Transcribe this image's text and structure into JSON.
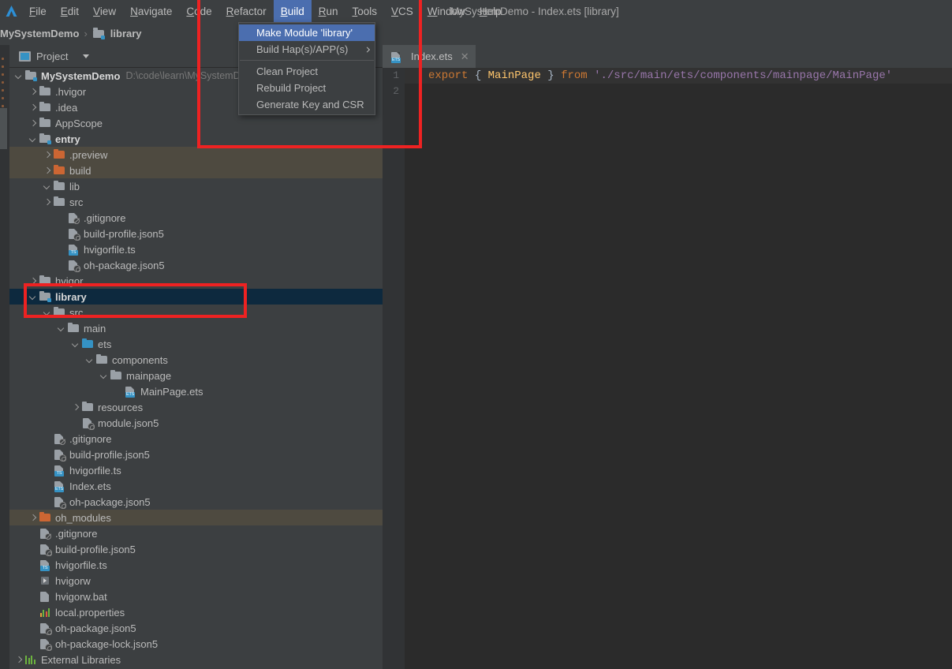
{
  "app": {
    "window_title": "MySystemDemo - Index.ets [library]",
    "logo_icon": "deveco-studio-logo-icon"
  },
  "menubar": {
    "items": [
      {
        "label": "File",
        "active": false
      },
      {
        "label": "Edit",
        "active": false
      },
      {
        "label": "View",
        "active": false
      },
      {
        "label": "Navigate",
        "active": false
      },
      {
        "label": "Code",
        "active": false
      },
      {
        "label": "Refactor",
        "active": false
      },
      {
        "label": "Build",
        "active": true
      },
      {
        "label": "Run",
        "active": false
      },
      {
        "label": "Tools",
        "active": false
      },
      {
        "label": "VCS",
        "active": false
      },
      {
        "label": "Window",
        "active": false
      },
      {
        "label": "Help",
        "active": false
      }
    ]
  },
  "build_menu": {
    "items": [
      {
        "label": "Make Module 'library'",
        "highlighted": true,
        "submenu": false,
        "separator_after": false
      },
      {
        "label": "Build Hap(s)/APP(s)",
        "highlighted": false,
        "submenu": true,
        "separator_after": true
      },
      {
        "label": "Clean Project",
        "highlighted": false,
        "submenu": false,
        "separator_after": false
      },
      {
        "label": "Rebuild Project",
        "highlighted": false,
        "submenu": false,
        "separator_after": false
      },
      {
        "label": "Generate Key and CSR",
        "highlighted": false,
        "submenu": false,
        "separator_after": false
      }
    ]
  },
  "breadcrumb": {
    "project": "MySystemDemo",
    "separator": "›",
    "module": "library",
    "module_icon": "module-folder-icon"
  },
  "tool_window": {
    "title": "Project",
    "view_icon": "project-view-icon",
    "dropdown_icon": "chevron-down-icon"
  },
  "tree": [
    {
      "indent": 0,
      "arrow": "down",
      "icon": "module-folder",
      "label": "MySystemDemo",
      "bold": true,
      "path": "D:\\code\\learn\\MySystemDemo",
      "state": "normal"
    },
    {
      "indent": 1,
      "arrow": "right",
      "icon": "folder",
      "label": ".hvigor",
      "bold": false,
      "path": "",
      "state": "normal"
    },
    {
      "indent": 1,
      "arrow": "right",
      "icon": "folder",
      "label": ".idea",
      "bold": false,
      "path": "",
      "state": "normal"
    },
    {
      "indent": 1,
      "arrow": "right",
      "icon": "folder",
      "label": "AppScope",
      "bold": false,
      "path": "",
      "state": "normal"
    },
    {
      "indent": 1,
      "arrow": "down",
      "icon": "module-folder",
      "label": "entry",
      "bold": true,
      "path": "",
      "state": "normal"
    },
    {
      "indent": 2,
      "arrow": "right",
      "icon": "folder-orange",
      "label": ".preview",
      "bold": false,
      "path": "",
      "state": "excluded"
    },
    {
      "indent": 2,
      "arrow": "right",
      "icon": "folder-orange",
      "label": "build",
      "bold": false,
      "path": "",
      "state": "excluded"
    },
    {
      "indent": 2,
      "arrow": "down",
      "icon": "folder",
      "label": "lib",
      "bold": false,
      "path": "",
      "state": "normal"
    },
    {
      "indent": 2,
      "arrow": "right",
      "icon": "folder",
      "label": "src",
      "bold": false,
      "path": "",
      "state": "normal"
    },
    {
      "indent": 3,
      "arrow": "none",
      "icon": "file-gitignore",
      "label": ".gitignore",
      "bold": false,
      "path": "",
      "state": "normal"
    },
    {
      "indent": 3,
      "arrow": "none",
      "icon": "file-json5",
      "label": "build-profile.json5",
      "bold": false,
      "path": "",
      "state": "normal"
    },
    {
      "indent": 3,
      "arrow": "none",
      "icon": "file-ts",
      "label": "hvigorfile.ts",
      "bold": false,
      "path": "",
      "state": "normal"
    },
    {
      "indent": 3,
      "arrow": "none",
      "icon": "file-json5",
      "label": "oh-package.json5",
      "bold": false,
      "path": "",
      "state": "normal"
    },
    {
      "indent": 1,
      "arrow": "right",
      "icon": "folder",
      "label": "hvigor",
      "bold": false,
      "path": "",
      "state": "normal"
    },
    {
      "indent": 1,
      "arrow": "down",
      "icon": "module-folder",
      "label": "library",
      "bold": true,
      "path": "",
      "state": "selected"
    },
    {
      "indent": 2,
      "arrow": "down",
      "icon": "folder",
      "label": "src",
      "bold": false,
      "path": "",
      "state": "normal"
    },
    {
      "indent": 3,
      "arrow": "down",
      "icon": "folder",
      "label": "main",
      "bold": false,
      "path": "",
      "state": "normal"
    },
    {
      "indent": 4,
      "arrow": "down",
      "icon": "folder-blue",
      "label": "ets",
      "bold": false,
      "path": "",
      "state": "normal"
    },
    {
      "indent": 5,
      "arrow": "down",
      "icon": "folder",
      "label": "components",
      "bold": false,
      "path": "",
      "state": "normal"
    },
    {
      "indent": 6,
      "arrow": "down",
      "icon": "folder",
      "label": "mainpage",
      "bold": false,
      "path": "",
      "state": "normal"
    },
    {
      "indent": 7,
      "arrow": "none",
      "icon": "file-ets",
      "label": "MainPage.ets",
      "bold": false,
      "path": "",
      "state": "normal"
    },
    {
      "indent": 4,
      "arrow": "right",
      "icon": "folder",
      "label": "resources",
      "bold": false,
      "path": "",
      "state": "normal"
    },
    {
      "indent": 4,
      "arrow": "none",
      "icon": "file-json5",
      "label": "module.json5",
      "bold": false,
      "path": "",
      "state": "normal"
    },
    {
      "indent": 2,
      "arrow": "none",
      "icon": "file-gitignore",
      "label": ".gitignore",
      "bold": false,
      "path": "",
      "state": "normal"
    },
    {
      "indent": 2,
      "arrow": "none",
      "icon": "file-json5",
      "label": "build-profile.json5",
      "bold": false,
      "path": "",
      "state": "normal"
    },
    {
      "indent": 2,
      "arrow": "none",
      "icon": "file-ts",
      "label": "hvigorfile.ts",
      "bold": false,
      "path": "",
      "state": "normal"
    },
    {
      "indent": 2,
      "arrow": "none",
      "icon": "file-ets",
      "label": "Index.ets",
      "bold": false,
      "path": "",
      "state": "normal"
    },
    {
      "indent": 2,
      "arrow": "none",
      "icon": "file-json5",
      "label": "oh-package.json5",
      "bold": false,
      "path": "",
      "state": "normal"
    },
    {
      "indent": 1,
      "arrow": "right",
      "icon": "folder-orange",
      "label": "oh_modules",
      "bold": false,
      "path": "",
      "state": "excluded"
    },
    {
      "indent": 1,
      "arrow": "none",
      "icon": "file-gitignore",
      "label": ".gitignore",
      "bold": false,
      "path": "",
      "state": "normal"
    },
    {
      "indent": 1,
      "arrow": "none",
      "icon": "file-json5",
      "label": "build-profile.json5",
      "bold": false,
      "path": "",
      "state": "normal"
    },
    {
      "indent": 1,
      "arrow": "none",
      "icon": "file-ts",
      "label": "hvigorfile.ts",
      "bold": false,
      "path": "",
      "state": "normal"
    },
    {
      "indent": 1,
      "arrow": "none",
      "icon": "file-run",
      "label": "hvigorw",
      "bold": false,
      "path": "",
      "state": "normal"
    },
    {
      "indent": 1,
      "arrow": "none",
      "icon": "file-plain",
      "label": "hvigorw.bat",
      "bold": false,
      "path": "",
      "state": "normal"
    },
    {
      "indent": 1,
      "arrow": "none",
      "icon": "file-props",
      "label": "local.properties",
      "bold": false,
      "path": "",
      "state": "normal"
    },
    {
      "indent": 1,
      "arrow": "none",
      "icon": "file-json5",
      "label": "oh-package.json5",
      "bold": false,
      "path": "",
      "state": "normal"
    },
    {
      "indent": 1,
      "arrow": "none",
      "icon": "file-json5",
      "label": "oh-package-lock.json5",
      "bold": false,
      "path": "",
      "state": "normal"
    },
    {
      "indent": 0,
      "arrow": "right",
      "icon": "ext-libs",
      "label": "External Libraries",
      "bold": false,
      "path": "",
      "state": "normal"
    }
  ],
  "editor": {
    "tab": {
      "label": "Index.ets",
      "icon": "ets-file-icon",
      "close_icon": "close-icon"
    },
    "gutter_lines": [
      "1",
      "2"
    ],
    "code": {
      "line1": {
        "kw_export": "export",
        "brace_open": "{",
        "identifier": "MainPage",
        "brace_close": "}",
        "kw_from": "from",
        "path": "'./src/main/ets/components/mainpage/MainPage'"
      }
    }
  },
  "annotations": [
    {
      "name": "build-menu-highlight",
      "color": "#ee2222"
    },
    {
      "name": "library-module-highlight",
      "color": "#ee2222"
    }
  ],
  "colors": {
    "chrome_bg": "#3c3f41",
    "editor_bg": "#2b2b2b",
    "selection_blue": "#4b6eaf",
    "tree_selected": "#0d293e",
    "excluded_row": "#4e4a40",
    "annotation_red": "#ee2222"
  }
}
